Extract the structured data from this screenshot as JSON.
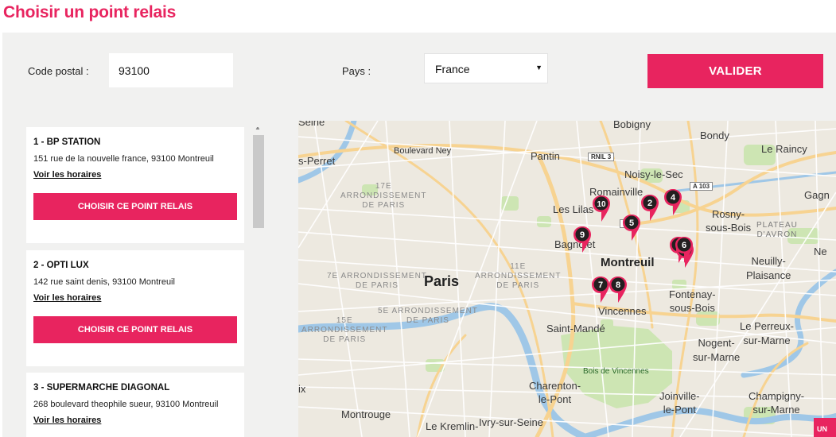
{
  "title": "Choisir un point relais",
  "form": {
    "postal_label": "Code postal :",
    "postal_value": "93100",
    "country_label": "Pays :",
    "country_selected": "France",
    "submit_label": "VALIDER"
  },
  "relays": [
    {
      "title": "1 - BP STATION",
      "address": "151 rue de la nouvelle france, 93100 Montreuil",
      "hours_link": "Voir les horaires",
      "button": "CHOISIR CE POINT RELAIS"
    },
    {
      "title": "2 - OPTI LUX",
      "address": "142 rue saint denis, 93100 Montreuil",
      "hours_link": "Voir les horaires",
      "button": "CHOISIR CE POINT RELAIS"
    },
    {
      "title": "3 - SUPERMARCHE DIAGONAL",
      "address": "268 boulevard theophile sueur, 93100 Montreuil",
      "hours_link": "Voir les horaires",
      "button": "CHOISIR CE POINT RELAIS"
    }
  ],
  "map": {
    "places": {
      "seine": "Seine",
      "bobigny": "Bobigny",
      "bondy": "Bondy",
      "le_raincy": "Le Raincy",
      "pre": "s-Perret",
      "bd_ney": "Boulevard Ney",
      "pantin": "Pantin",
      "rnil3": "RNIL 3",
      "noisy": "Noisy-le-Sec",
      "romainville": "Romainville",
      "a103": "A 103",
      "gagny": "Gagn",
      "arr17": "17E\nARRONDISSEMENT\nDE PARIS",
      "les_lilas": "Les Lilas",
      "rosny": "Rosny-\nsous-Bois",
      "plateau": "PLATEAU\nD'AVRON",
      "bagnolet": "Bagnolet",
      "montreuil": "Montreuil",
      "ne": "Ne",
      "neuilly": "Neuilly-\nPlaisance",
      "arr7": "7E ARRONDISSEMENT\nDE PARIS",
      "paris": "Paris",
      "arr11": "11E\nARRONDISSEMENT\nDE PARIS",
      "fontenay": "Fontenay-\nsous-Bois",
      "vincennes": "Vincennes",
      "arr5": "5E ARRONDISSEMENT\nDE PARIS",
      "arr15": "15E\nARRONDISSEMENT\nDE PARIS",
      "saint_mande": "Saint-Mandé",
      "perreux": "Le Perreux-\nsur-Marne",
      "nogent": "Nogent-\nsur-Marne",
      "bois": "Bois de Vincennes",
      "ix": "ix",
      "charenton": "Charenton-\nle-Pont",
      "joinville": "Joinville-\nle-Pont",
      "champigny": "Champigny-\nsur-Marne",
      "montrouge": "Montrouge",
      "kremlin": "Le Kremlin-",
      "ivry": "Ivry-sur-Seine",
      "a4": "A"
    },
    "markers": [
      "1",
      "2",
      "3",
      "4",
      "5",
      "6",
      "7",
      "8",
      "9",
      "10"
    ],
    "corner_button": "UN"
  },
  "colors": {
    "accent": "#e8245f",
    "map_bg": "#ede9e0",
    "park": "#cde5b3",
    "water": "#9fc7e7",
    "road": "#f7d391"
  }
}
